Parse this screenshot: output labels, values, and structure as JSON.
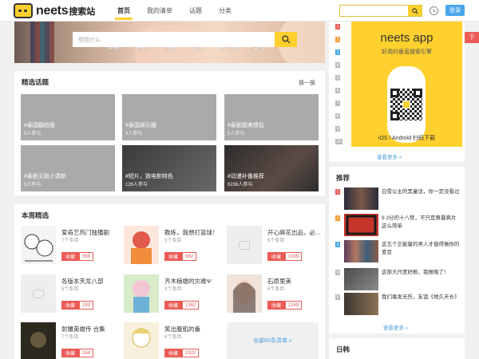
{
  "header": {
    "logo_text": "neets",
    "logo_sub": "搜索站",
    "nav": [
      "首页",
      "我的清单",
      "话题",
      "分类"
    ],
    "search_btn_icon": "search-icon",
    "login_label": "登录"
  },
  "banner": {
    "categories": [
      "美剧",
      "日剧",
      "韩剧",
      "动漫",
      "国产剧",
      "更多"
    ],
    "search_placeholder": "想找什么"
  },
  "topics": {
    "title": "精选话题",
    "swap_label": "换一换",
    "items": [
      {
        "title": "#泰国翻拍版",
        "count": "5人参与"
      },
      {
        "title": "#泰国娱乐圈",
        "count": "4人参与"
      },
      {
        "title": "#泰剧甜美情侣",
        "count": "5人参与"
      },
      {
        "title": "#泰剧无敌小清新",
        "count": "5人参与"
      },
      {
        "title": "#短片，致电影特色",
        "count": "126人参与"
      },
      {
        "title": "#动漫补番推荐",
        "count": "6236人参与"
      }
    ]
  },
  "weekly": {
    "title": "本周精选",
    "fav_label": "收藏",
    "all_label": "全部60条清单 »",
    "items": [
      {
        "title": "爱奇艺热门独播剧",
        "count": "7个条目",
        "fav": "569"
      },
      {
        "title": "教练，我想打篮球！",
        "count": "5个条目",
        "fav": "682"
      },
      {
        "title": "开心麻花出品，必...",
        "count": "6个条目",
        "fav": "1909"
      },
      {
        "title": "各版本天龙八部",
        "count": "5个条目",
        "fav": "189"
      },
      {
        "title": "齐木楠雄的灾难Ψ",
        "count": "5个条目",
        "fav": "1362"
      },
      {
        "title": "石原里美",
        "count": "6个条目",
        "fav": "1249"
      },
      {
        "title": "射雕英雄传 合集",
        "count": "7个条目",
        "fav": "264"
      },
      {
        "title": "笑出腹肌的番",
        "count": "6个条目",
        "fav": "1922"
      }
    ]
  },
  "app": {
    "title": "neets app",
    "subtitle": "好用的垂直搜索引擎",
    "footer": "iOS / Android 扫码下载",
    "side_tab": "下"
  },
  "top_rank": {
    "more_label": "查看更多 »",
    "nums": [
      "1",
      "2",
      "3",
      "4",
      "5",
      "6",
      "7",
      "8",
      "9",
      "10"
    ]
  },
  "recommend": {
    "title": "推荐",
    "more_label": "查看更多 »",
    "items": [
      {
        "rank": "1",
        "text": "白雪公主的黑童话，你一定没看过"
      },
      {
        "rank": "2",
        "text": "9.3分的十八禁，不只是黄暴爽片这么简单"
      },
      {
        "rank": "3",
        "text": "这五个正能量的男人才值得做你的爱豆"
      },
      {
        "rank": "4",
        "text": "这部大尺度好剧，我推晚了！"
      },
      {
        "rank": "5",
        "text": "我们毫发无伤，友谊《地久天长》"
      }
    ]
  },
  "next_section": {
    "title": "日韩"
  },
  "colors": {
    "accent": "#ffd02e",
    "red": "#ec5b56",
    "blue": "#49a6ea",
    "link": "#4c9ed9"
  }
}
